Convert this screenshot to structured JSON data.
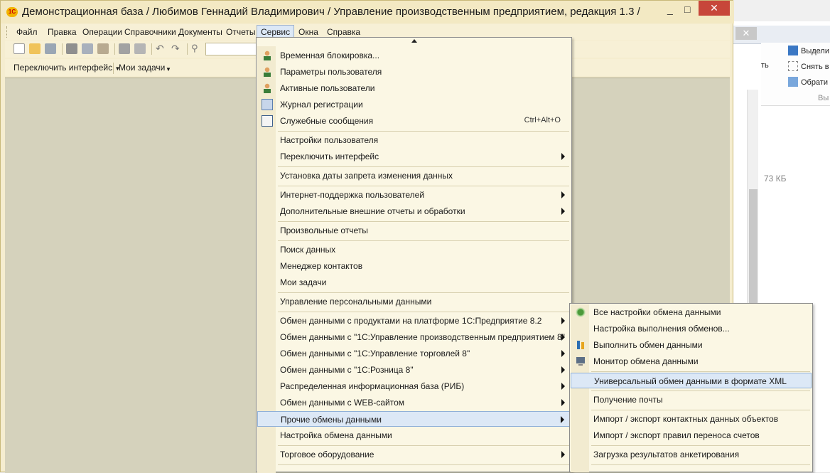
{
  "window": {
    "title": "Демонстрационная база / Любимов Геннадий Владимирович /  Управление производственным предприятием, редакция 1.3 /",
    "app_icon": "1c-logo-icon",
    "minimize": "_",
    "maximize": "□",
    "close": "✕"
  },
  "menubar": {
    "items": [
      "Файл",
      "Правка",
      "Операции",
      "Справочники",
      "Документы",
      "Отчеты",
      "Сервис",
      "Окна",
      "Справка"
    ],
    "active_index": 6
  },
  "toolbar2": {
    "switch_interface": "Переключить интерфейс",
    "my_tasks": "Мои задачи"
  },
  "service_menu": {
    "items": [
      {
        "label": "Временная блокировка...",
        "icon": "user-lock-icon"
      },
      {
        "label": "Параметры пользователя",
        "icon": "user-params-icon"
      },
      {
        "label": "Активные пользователи",
        "icon": "active-users-icon"
      },
      {
        "label": "Журнал регистрации",
        "icon": "log-icon"
      },
      {
        "label": "Служебные сообщения",
        "icon": "messages-icon",
        "shortcut": "Ctrl+Alt+O"
      },
      {
        "label": "Настройки пользователя"
      },
      {
        "label": "Переключить интерфейс",
        "submenu": true
      },
      {
        "label": "Установка даты запрета изменения данных"
      },
      {
        "label": "Интернет-поддержка пользователей",
        "submenu": true
      },
      {
        "label": "Дополнительные внешние отчеты и обработки",
        "submenu": true
      },
      {
        "label": "Произвольные отчеты"
      },
      {
        "label": "Поиск данных"
      },
      {
        "label": "Менеджер контактов"
      },
      {
        "label": "Мои задачи"
      },
      {
        "label": "Управление персональными данными"
      },
      {
        "label": "Обмен данными с продуктами на платформе 1С:Предприятие 8.2",
        "submenu": true
      },
      {
        "label": "Обмен данными с \"1С:Управление производственным предприятием 8\"",
        "submenu": true
      },
      {
        "label": "Обмен данными с \"1С:Управление торговлей 8\"",
        "submenu": true
      },
      {
        "label": "Обмен данными с \"1С:Розница 8\"",
        "submenu": true
      },
      {
        "label": "Распределенная информационная база (РИБ)",
        "submenu": true
      },
      {
        "label": "Обмен данными с WEB-сайтом",
        "submenu": true
      },
      {
        "label": "Прочие обмены данными",
        "submenu": true,
        "highlighted": true
      },
      {
        "label": "Настройка обмена данными"
      },
      {
        "label": "Торговое оборудование",
        "submenu": true
      }
    ]
  },
  "other_exchanges_submenu": {
    "items": [
      {
        "label": "Все настройки обмена данными",
        "icon": "exchange-settings-icon"
      },
      {
        "label": "Настройка выполнения обменов..."
      },
      {
        "label": "Выполнить обмен данными",
        "icon": "run-exchange-icon"
      },
      {
        "label": "Монитор обмена данными",
        "icon": "monitor-icon"
      },
      {
        "label": "Универсальный обмен данными в формате XML",
        "highlighted": true
      },
      {
        "label": "Получение почты"
      },
      {
        "label": "Импорт / экспорт контактных данных объектов"
      },
      {
        "label": "Импорт / экспорт правил переноса счетов"
      },
      {
        "label": "Загрузка результатов анкетирования"
      }
    ]
  },
  "background_window": {
    "ribbon": [
      "Выдели",
      "Снять в",
      "Обрати"
    ],
    "ribbon_right": [
      "ть",
      "Вы"
    ],
    "size_text": "73 КБ",
    "close": "✕"
  }
}
